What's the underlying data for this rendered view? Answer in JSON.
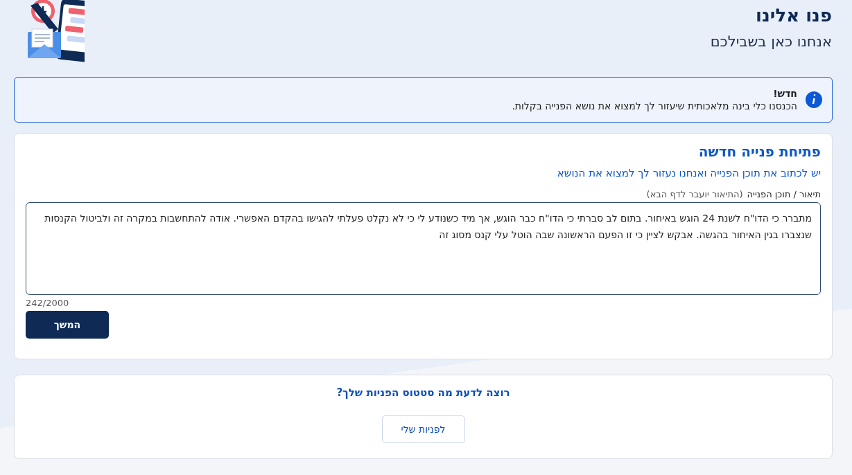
{
  "header": {
    "title": "פנו אלינו",
    "subtitle": "אנחנו כאן בשבילכם"
  },
  "notice": {
    "title": "חדש!",
    "text": "הכנסנו כלי בינה מלאכותית שיעזור לך למצוא את נושא הפנייה בקלות."
  },
  "form": {
    "title": "פתיחת פנייה חדשה",
    "intro": "יש לכתוב את תוכן הפנייה ואנחנו נעזור לך למצוא את הנושא",
    "field_label": "תיאור / תוכן הפנייה",
    "field_hint": "(התיאור יועבר לדף הבא)",
    "value": "מתברר כי הדו\"ח לשנת 24 הוגש באיחור. בתום לב סברתי כי הדו\"ח כבר הוגש, אך מיד כשנודע לי כי לא נקלט פעלתי להגישו בהקדם האפשרי. אודה להתחשבות במקרה זה ולביטול הקנסות שנצברו בגין האיחור בהגשה. אבקש לציין כי זו הפעם הראשונה שבה הוטל עלי קנס מסוג זה",
    "counter": "242/2000",
    "button": "המשך"
  },
  "status": {
    "question": "רוצה לדעת מה סטטוס הפניות שלך?",
    "button": "לפניות שלי"
  }
}
